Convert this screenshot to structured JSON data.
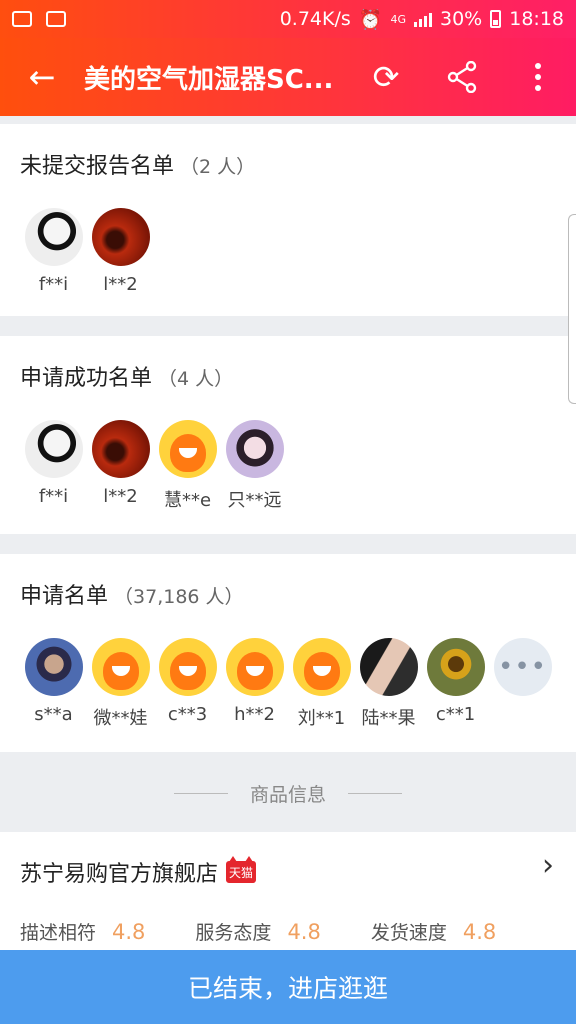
{
  "status_bar": {
    "speed": "0.74K/s",
    "network": "4G",
    "battery": "30%",
    "time": "18:18"
  },
  "nav": {
    "title": "美的空气加湿器SC...",
    "back_icon": "arrow-left-icon",
    "refresh_icon": "refresh-icon",
    "share_icon": "share-icon",
    "more_icon": "more-vertical-icon"
  },
  "not_submitted": {
    "title": "未提交报告名单",
    "count": "（2 人）",
    "users": [
      {
        "name": "f**i",
        "avatar": "sketch"
      },
      {
        "name": "l**2",
        "avatar": "dark"
      }
    ]
  },
  "success": {
    "title": "申请成功名单",
    "count": "（4 人）",
    "users": [
      {
        "name": "f**i",
        "avatar": "sketch"
      },
      {
        "name": "l**2",
        "avatar": "dark"
      },
      {
        "name": "慧**e",
        "avatar": "mascot"
      },
      {
        "name": "只**远",
        "avatar": "girl"
      }
    ]
  },
  "applicants": {
    "title": "申请名单",
    "count": "（37,186 人）",
    "users": [
      {
        "name": "s**a",
        "avatar": "kid"
      },
      {
        "name": "微**娃",
        "avatar": "mascot"
      },
      {
        "name": "c**3",
        "avatar": "mascot"
      },
      {
        "name": "h**2",
        "avatar": "mascot"
      },
      {
        "name": "刘**1",
        "avatar": "mascot"
      },
      {
        "name": "陆**果",
        "avatar": "couple"
      },
      {
        "name": "c**1",
        "avatar": "sun"
      }
    ],
    "more_label": "•••"
  },
  "product_divider": "商品信息",
  "store": {
    "name": "苏宁易购官方旗舰店",
    "badge": "天猫",
    "ratings": [
      {
        "label": "描述相符",
        "value": "4.8"
      },
      {
        "label": "服务态度",
        "value": "4.8"
      },
      {
        "label": "发货速度",
        "value": "4.8"
      }
    ]
  },
  "bottom_button": "已结束，进店逛逛",
  "colors": {
    "header_start": "#ff4f0d",
    "header_end": "#ff1c63",
    "button_bg": "#4d9cee",
    "rating_value": "#f0a060"
  }
}
